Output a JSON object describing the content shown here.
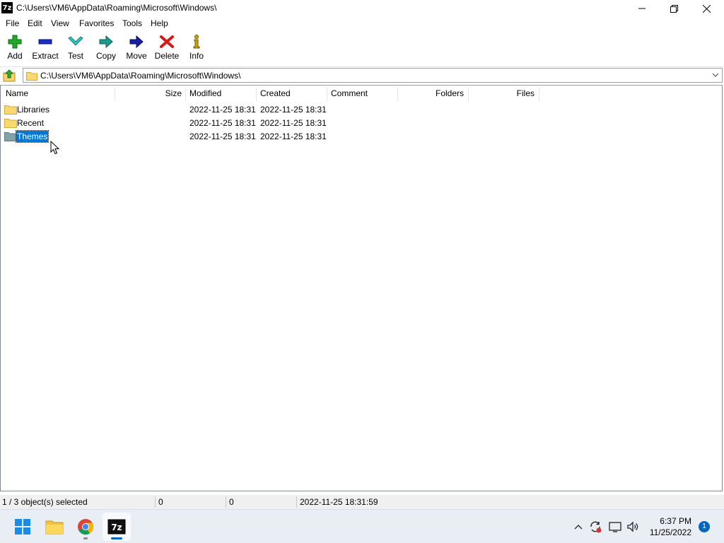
{
  "window": {
    "title": "C:\\Users\\VM6\\AppData\\Roaming\\Microsoft\\Windows\\",
    "app_icon_text": "7z"
  },
  "menu": [
    "File",
    "Edit",
    "View",
    "Favorites",
    "Tools",
    "Help"
  ],
  "toolbar": {
    "add": "Add",
    "extract": "Extract",
    "test": "Test",
    "copy": "Copy",
    "move": "Move",
    "delete": "Delete",
    "info": "Info"
  },
  "address": {
    "path": "C:\\Users\\VM6\\AppData\\Roaming\\Microsoft\\Windows\\"
  },
  "columns": [
    "Name",
    "Size",
    "Modified",
    "Created",
    "Comment",
    "Folders",
    "Files"
  ],
  "rows": [
    {
      "name": "Libraries",
      "size": "",
      "modified": "2022-11-25 18:31",
      "created": "2022-11-25 18:31",
      "selected": false
    },
    {
      "name": "Recent",
      "size": "",
      "modified": "2022-11-25 18:31",
      "created": "2022-11-25 18:31",
      "selected": false
    },
    {
      "name": "Themes",
      "size": "",
      "modified": "2022-11-25 18:31",
      "created": "2022-11-25 18:31",
      "selected": true
    }
  ],
  "status": {
    "selection": "1 / 3 object(s) selected",
    "size1": "0",
    "size2": "0",
    "timestamp": "2022-11-25 18:31:59"
  },
  "taskbar": {
    "apps": [
      "start-icon",
      "file-explorer-icon",
      "chrome-icon",
      "7zip-icon"
    ],
    "time": "6:37 PM",
    "date": "11/25/2022",
    "notification_count": "1"
  },
  "colors": {
    "selection": "#0078d7",
    "folder": "#f8d775",
    "accent": "#0067c0"
  }
}
